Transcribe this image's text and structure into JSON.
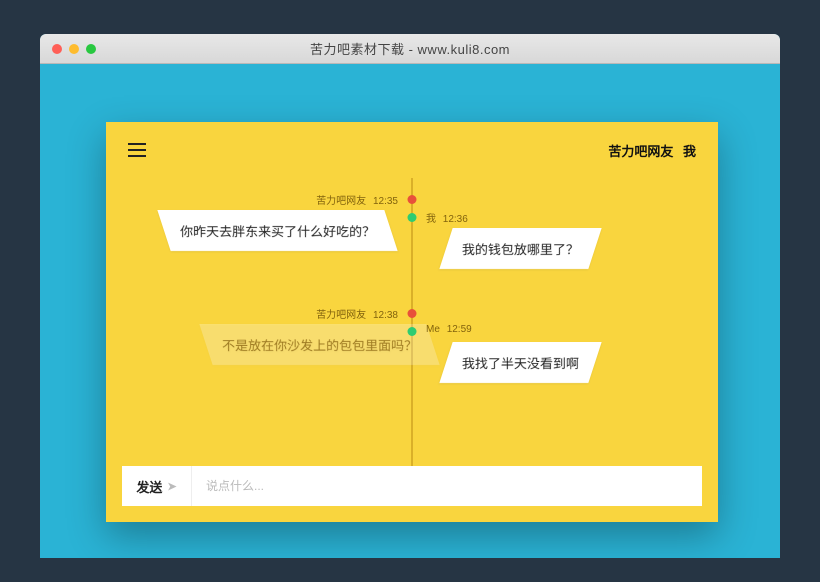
{
  "browser": {
    "title": "苦力吧素材下载 - www.kuli8.com"
  },
  "chat": {
    "participants": {
      "left": "苦力吧网友",
      "right": "我"
    },
    "input": {
      "send_label": "发送",
      "placeholder": "说点什么..."
    },
    "messages": [
      {
        "side": "left",
        "name": "苦力吧网友",
        "time": "12:35",
        "text": "你昨天去胖东来买了什么好吃的？",
        "faded": false
      },
      {
        "side": "right",
        "name": "我",
        "time": "12:36",
        "text": "我的钱包放哪里了？",
        "faded": false
      },
      {
        "side": "left",
        "name": "苦力吧网友",
        "time": "12:38",
        "text": "不是放在你沙发上的包包里面吗？",
        "faded": true
      },
      {
        "side": "right",
        "name": "Me",
        "time": "12:59",
        "text": "我找了半天没看到啊",
        "faded": false
      }
    ]
  }
}
